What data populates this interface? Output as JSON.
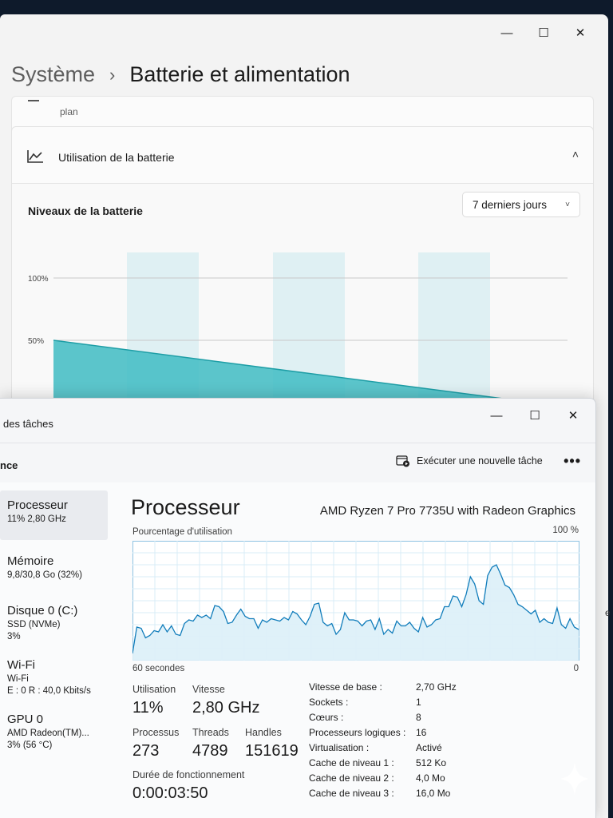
{
  "settings": {
    "breadcrumb_parent": "Système",
    "breadcrumb_sep": "›",
    "breadcrumb_current": "Batterie et alimentation",
    "prev_card_subtext": "plan",
    "battery_usage_title": "Utilisation de la batterie",
    "chart_title": "Niveaux de la batterie",
    "range_value": "7 derniers jours",
    "right_edge_text": "e"
  },
  "chart_data": {
    "type": "area",
    "title": "Niveaux de la batterie",
    "y_ticks": [
      "100%",
      "50%"
    ],
    "ylim": [
      0,
      100
    ],
    "series": [
      {
        "values": [
          50,
          2
        ]
      }
    ]
  },
  "taskmgr": {
    "app_title": "des tâches",
    "page_label": "nce",
    "run_task_label": "Exécuter une nouvelle tâche",
    "more_label": "•••",
    "sidebar": [
      {
        "name": "Processeur",
        "line1": "11% 2,80 GHz",
        "line2": ""
      },
      {
        "name": "Mémoire",
        "line1": "9,8/30,8 Go (32%)",
        "line2": ""
      },
      {
        "name": "Disque 0 (C:)",
        "line1": "SSD (NVMe)",
        "line2": "3%"
      },
      {
        "name": "Wi-Fi",
        "line1": "Wi-Fi",
        "line2": "E : 0 R : 40,0 Kbits/s"
      },
      {
        "name": "GPU 0",
        "line1": "AMD Radeon(TM)...",
        "line2": "3% (56 °C)"
      }
    ],
    "perf_title": "Processeur",
    "cpu_name": "AMD Ryzen 7 Pro 7735U with Radeon Graphics",
    "graph_label": "Pourcentage d'utilisation",
    "graph_max": "100 %",
    "graph_left": "60 secondes",
    "graph_right": "0",
    "cpu_usage_history": [
      6,
      28,
      27,
      19,
      21,
      25,
      24,
      30,
      24,
      29,
      22,
      21,
      31,
      34,
      33,
      38,
      36,
      38,
      35,
      46,
      45,
      41,
      31,
      32,
      38,
      43,
      37,
      35,
      35,
      27,
      34,
      32,
      35,
      34,
      33,
      36,
      34,
      41,
      39,
      34,
      30,
      37,
      47,
      48,
      32,
      29,
      31,
      22,
      26,
      40,
      34,
      34,
      33,
      29,
      33,
      34,
      26,
      35,
      22,
      26,
      23,
      33,
      29,
      29,
      32,
      27,
      24,
      36,
      28,
      30,
      34,
      35,
      45,
      45,
      54,
      53,
      45,
      55,
      70,
      64,
      50,
      47,
      71,
      78,
      80,
      72,
      63,
      61,
      55,
      47,
      45,
      42,
      39,
      42,
      32,
      35,
      32,
      31,
      44,
      30,
      27,
      35,
      28,
      26
    ],
    "stats": {
      "usage_label": "Utilisation",
      "usage": "11%",
      "speed_label": "Vitesse",
      "speed": "2,80 GHz",
      "processes_label": "Processus",
      "processes": "273",
      "threads_label": "Threads",
      "threads": "4789",
      "handles_label": "Handles",
      "handles": "151619",
      "uptime_label": "Durée de fonctionnement",
      "uptime": "0:00:03:50"
    },
    "specs": [
      {
        "k": "Vitesse de base :",
        "v": "2,70 GHz"
      },
      {
        "k": "Sockets :",
        "v": "1"
      },
      {
        "k": "Cœurs :",
        "v": "8"
      },
      {
        "k": "Processeurs logiques :",
        "v": "16"
      },
      {
        "k": "Virtualisation :",
        "v": "Activé"
      },
      {
        "k": "Cache de niveau 1 :",
        "v": "512 Ko"
      },
      {
        "k": "Cache de niveau 2 :",
        "v": "4,0 Mo"
      },
      {
        "k": "Cache de niveau 3 :",
        "v": "16,0 Mo"
      }
    ]
  },
  "colors": {
    "battery_fill": "#3fbcc3",
    "battery_bar": "#dff0f3",
    "cpu_line": "#117dbb",
    "cpu_fill": "#dceff8",
    "cpu_grid": "#d9ecf7"
  }
}
